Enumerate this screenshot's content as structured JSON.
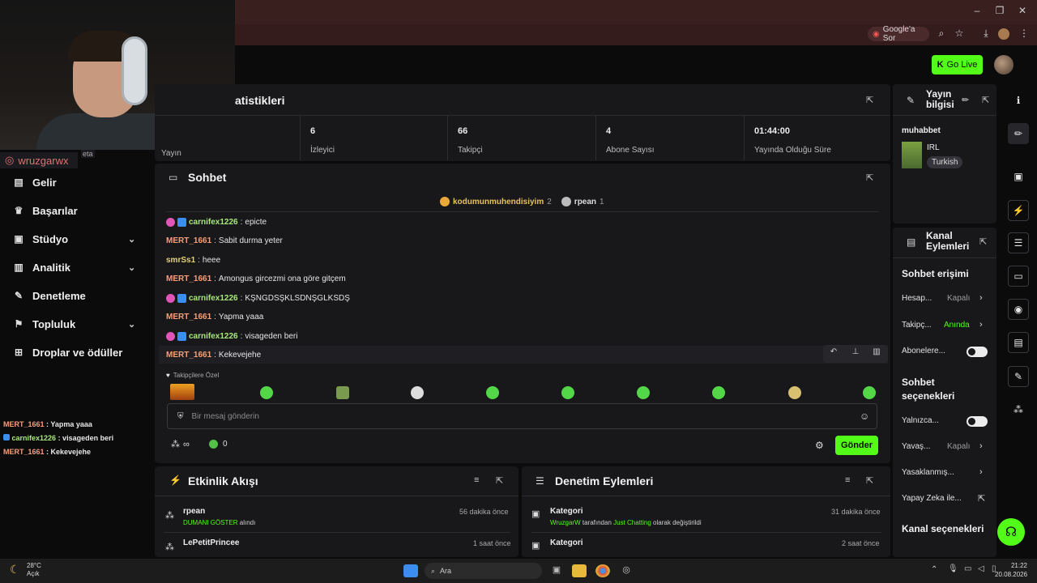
{
  "browser": {
    "ask_google": "Google'a Sor"
  },
  "header": {
    "go_live": "Go Live"
  },
  "webcam": {
    "handle": "wruzgarwx",
    "partial_label": "eta"
  },
  "sidebar": {
    "items": [
      {
        "label": "Gelir",
        "icon": "dollar-icon"
      },
      {
        "label": "Başarılar",
        "icon": "trophy-icon"
      },
      {
        "label": "Stüdyo",
        "icon": "studio-icon",
        "chevron": true
      },
      {
        "label": "Analitik",
        "icon": "chart-icon",
        "chevron": true
      },
      {
        "label": "Denetleme",
        "icon": "wrench-icon"
      },
      {
        "label": "Topluluk",
        "icon": "community-icon",
        "chevron": true
      },
      {
        "label": "Droplar ve ödüller",
        "icon": "gift-icon"
      }
    ]
  },
  "overlay_chat": [
    {
      "user": "MERT_1661",
      "text": " : Yapma yaaa"
    },
    {
      "user": "carnifex1226",
      "text": " : visageden beri"
    },
    {
      "user": "MERT_1661",
      "text": " : Kekevejehe"
    }
  ],
  "stats": {
    "title": "atistikleri",
    "partial_label": "Yayın",
    "cells": [
      {
        "value": "6",
        "label": "İzleyici"
      },
      {
        "value": "66",
        "label": "Takipçi"
      },
      {
        "value": "4",
        "label": "Abone Sayısı"
      },
      {
        "value": "01:44:00",
        "label": "Yayında Olduğu Süre"
      }
    ]
  },
  "chat": {
    "title": "Sohbet",
    "top_gifters": [
      {
        "name": "kodumunmuhendisiyim",
        "count": "2"
      },
      {
        "name": "rpean",
        "count": "1"
      }
    ],
    "messages": [
      {
        "user": "carnifex1226",
        "text": "epicte",
        "badges": true,
        "color": "green"
      },
      {
        "user": "MERT_1661",
        "text": "Sabit durma yeter",
        "badges": false,
        "color": "pink"
      },
      {
        "user": "smrSs1",
        "text": "heee",
        "badges": false,
        "color": "yellow"
      },
      {
        "user": "MERT_1661",
        "text": "Amongus gircezmi ona göre gitçem",
        "badges": false,
        "color": "pink"
      },
      {
        "user": "carnifex1226",
        "text": "KŞNGDSŞKLSDNŞGLKSDŞ",
        "badges": true,
        "color": "green"
      },
      {
        "user": "MERT_1661",
        "text": "Yapma yaaa",
        "badges": false,
        "color": "pink"
      },
      {
        "user": "carnifex1226",
        "text": "visageden beri",
        "badges": true,
        "color": "green"
      },
      {
        "user": "MERT_1661",
        "text": "Kekevejehe",
        "badges": false,
        "color": "pink"
      }
    ],
    "emote_section": "Takipçilere Özel",
    "placeholder": "Bir mesaj gönderin",
    "points_infinite": "∞",
    "points_count": "0",
    "send": "Gönder"
  },
  "activity": {
    "title": "Etkinlik Akışı",
    "items": [
      {
        "name": "rpean",
        "time": "56 dakika önce",
        "highlight": "DUMANI GÖSTER",
        "rest": " alındı"
      },
      {
        "name": "LePetitPrincee",
        "time": "1 saat önce"
      }
    ]
  },
  "moderation": {
    "title": "Denetim Eylemleri",
    "items": [
      {
        "name": "Kategori",
        "time": "31 dakika önce",
        "user": "WruzgarW",
        "mid": " tarafından ",
        "cat": "Just Chatting",
        "rest": " olarak değiştirildi"
      },
      {
        "name": "Kategori",
        "time": "2 saat önce"
      }
    ]
  },
  "stream_info": {
    "title_line1": "Yayın",
    "title_line2": "bilgisi",
    "stream_title": "muhabbet",
    "category": "IRL",
    "language": "Turkish"
  },
  "channel_actions": {
    "title_line1": "Kanal",
    "title_line2": "Eylemleri",
    "chat_access": "Sohbet erişimi",
    "rows": [
      {
        "label": "Hesap...",
        "value": "Kapalı"
      },
      {
        "label": "Takipç...",
        "value": "Anında"
      },
      {
        "label": "Abonelere..."
      }
    ],
    "chat_options_1": "Sohbet",
    "chat_options_2": "seçenekleri",
    "rows2": [
      {
        "label": "Yalnızca..."
      },
      {
        "label": "Yavaş...",
        "value": "Kapalı"
      },
      {
        "label": "Yasaklanmış..."
      },
      {
        "label": "Yapay Zeka ile..."
      }
    ],
    "channel_options": "Kanal seçenekleri"
  },
  "taskbar": {
    "temp": "28°C",
    "weather": "Açık",
    "search": "Ara",
    "time": "21:22",
    "date": "20.08.2026"
  },
  "colors": {
    "accent": "#53fc18",
    "panel": "#18181b",
    "background": "#0b0b0c"
  }
}
